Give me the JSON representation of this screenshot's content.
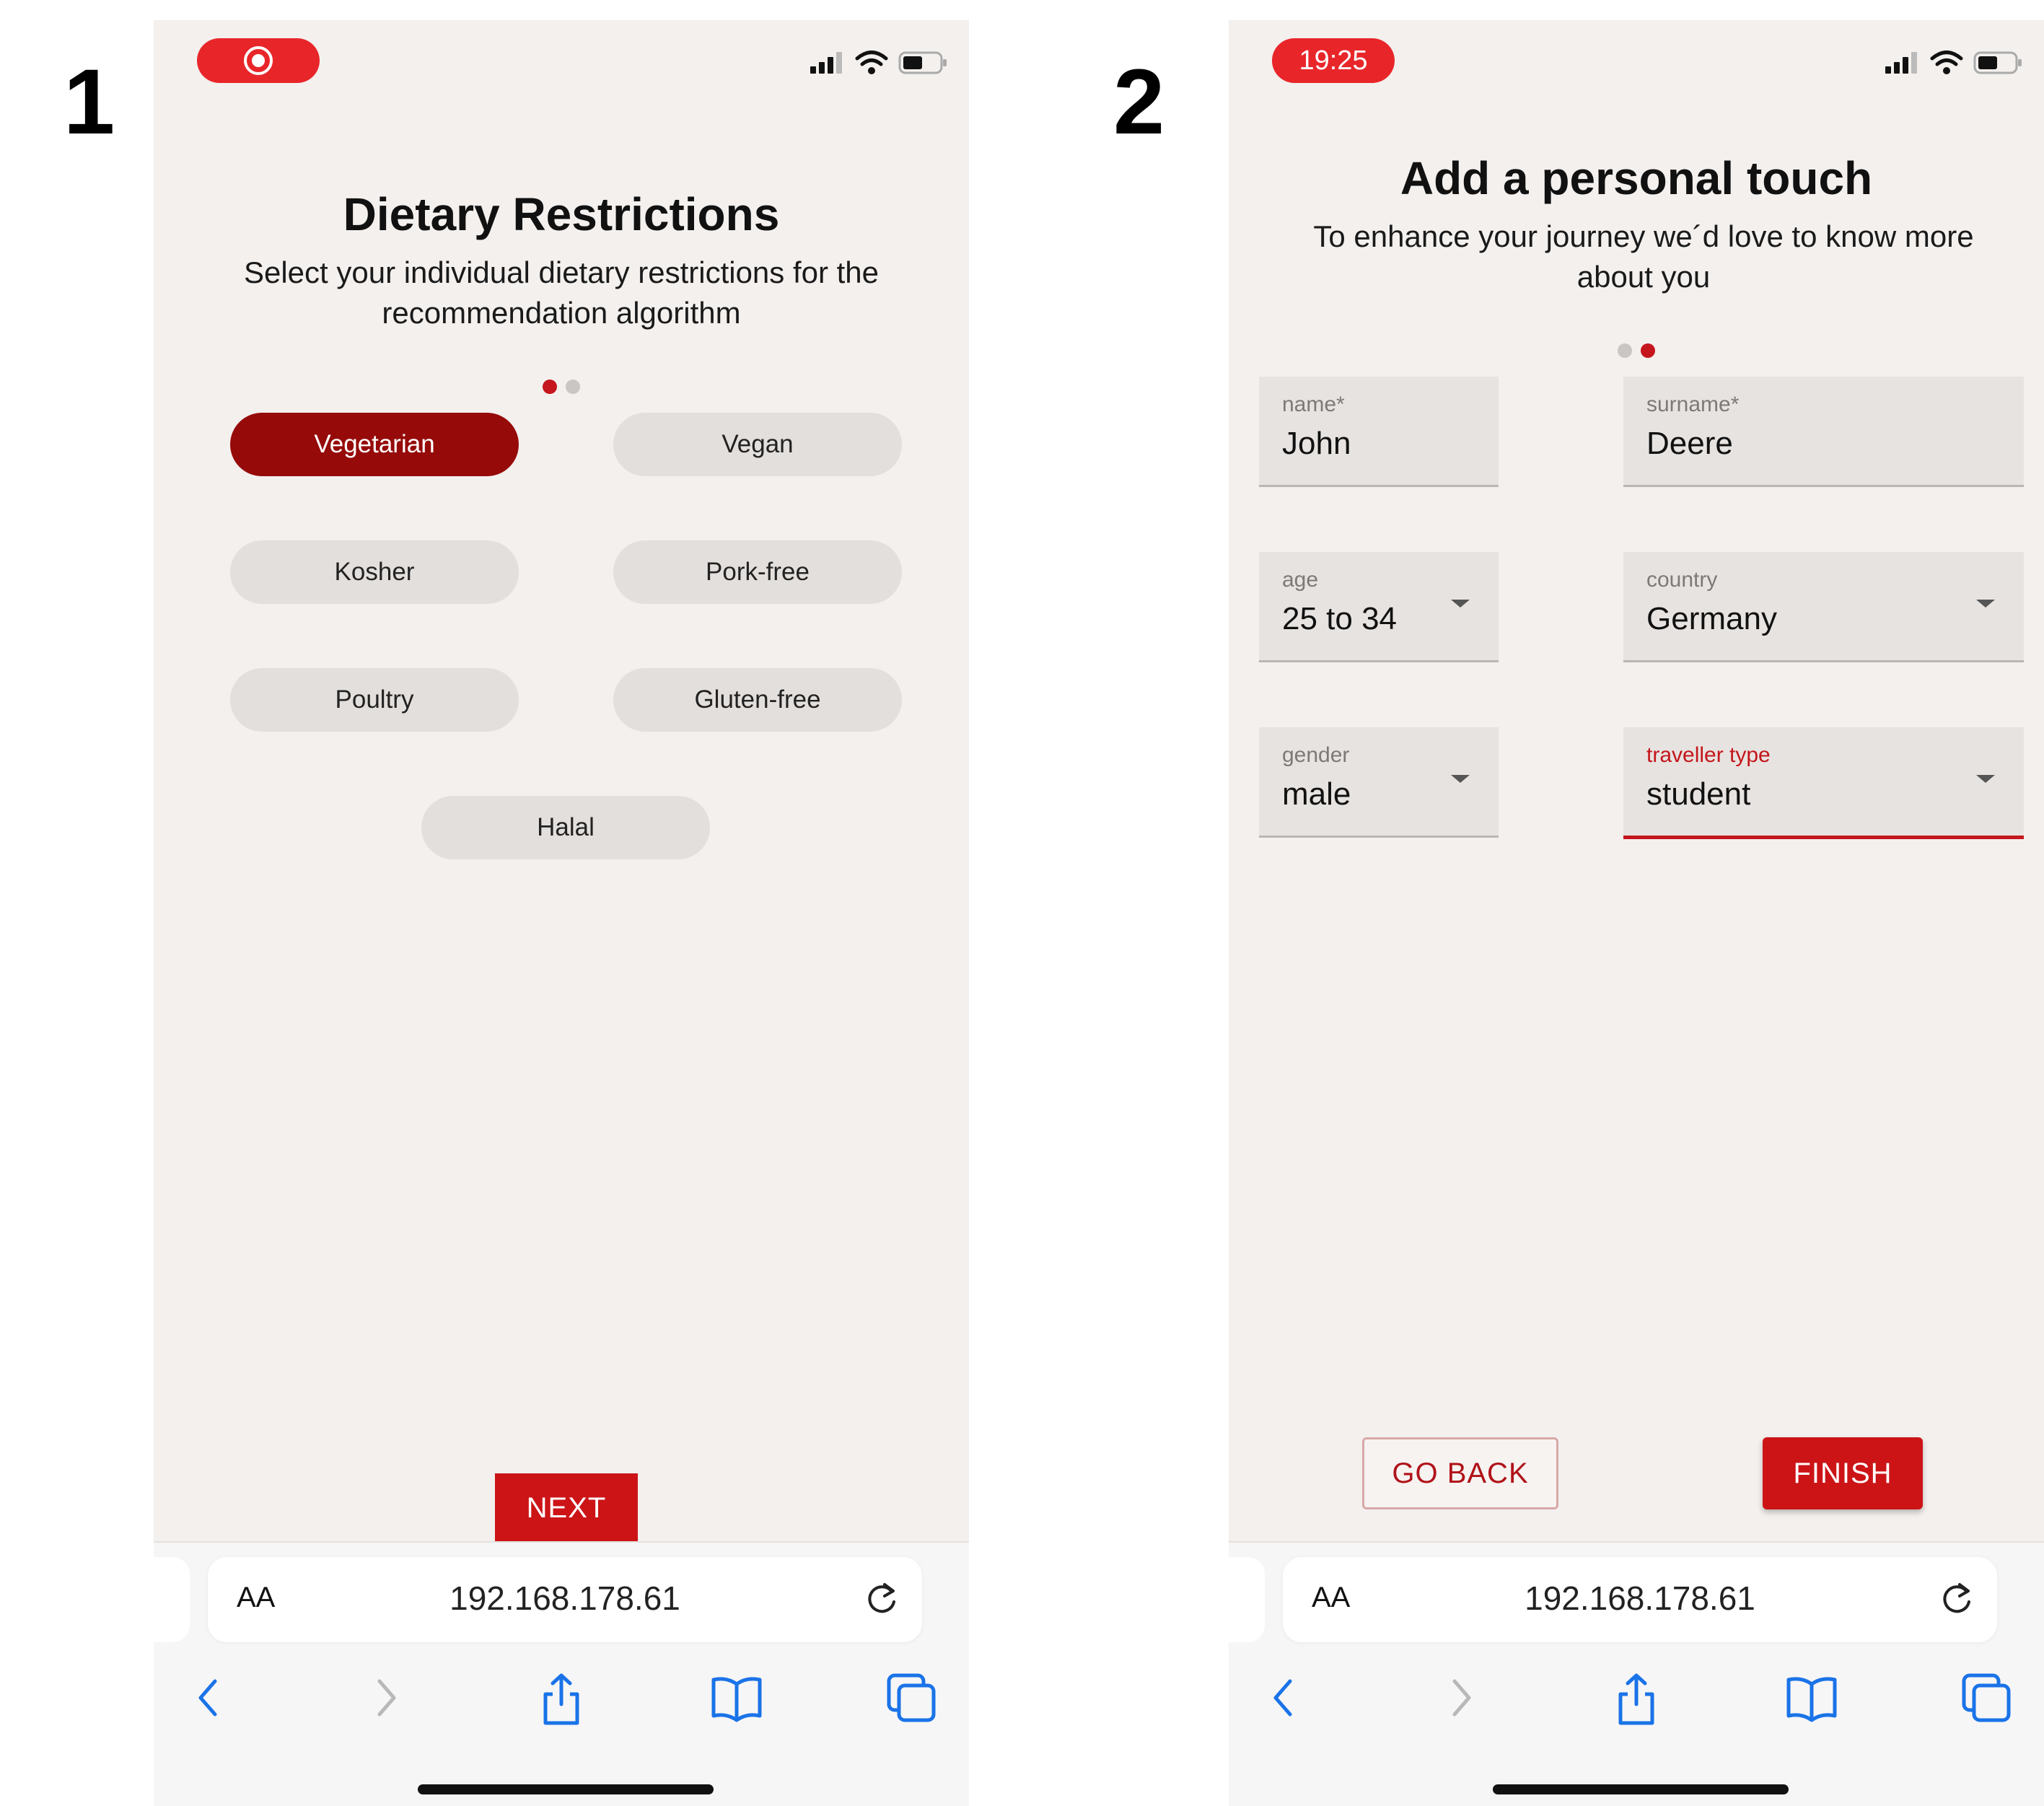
{
  "figure_labels": [
    "1",
    "2"
  ],
  "colors": {
    "accent": "#cc1417",
    "chip_selected": "#960a0a",
    "screen_bg": "#f3f0ee"
  },
  "screen1": {
    "status": {
      "indicator_icon": "record-icon"
    },
    "title": "Dietary Restrictions",
    "subtitle": "Select your individual dietary restrictions for the recommendation algorithm",
    "steps": {
      "total": 2,
      "current": 1
    },
    "chips": [
      {
        "label": "Vegetarian",
        "selected": true
      },
      {
        "label": "Vegan",
        "selected": false
      },
      {
        "label": "Kosher",
        "selected": false
      },
      {
        "label": "Pork-free",
        "selected": false
      },
      {
        "label": "Poultry",
        "selected": false
      },
      {
        "label": "Gluten-free",
        "selected": false
      },
      {
        "label": "Halal",
        "selected": false
      }
    ],
    "next_label": "NEXT",
    "browser": {
      "aa": "AA",
      "url": "192.168.178.61"
    }
  },
  "screen2": {
    "status": {
      "time": "19:25"
    },
    "title": "Add a personal touch",
    "subtitle": "To enhance your journey we´d love to know more about you",
    "steps": {
      "total": 2,
      "current": 2
    },
    "fields": {
      "name": {
        "label": "name*",
        "value": "John"
      },
      "surname": {
        "label": "surname*",
        "value": "Deere"
      },
      "age": {
        "label": "age",
        "value": "25 to 34"
      },
      "country": {
        "label": "country",
        "value": "Germany"
      },
      "gender": {
        "label": "gender",
        "value": "male"
      },
      "traveller_type": {
        "label": "traveller type",
        "value": "student"
      }
    },
    "back_label": "GO BACK",
    "finish_label": "FINISH",
    "browser": {
      "aa": "AA",
      "url": "192.168.178.61"
    }
  }
}
